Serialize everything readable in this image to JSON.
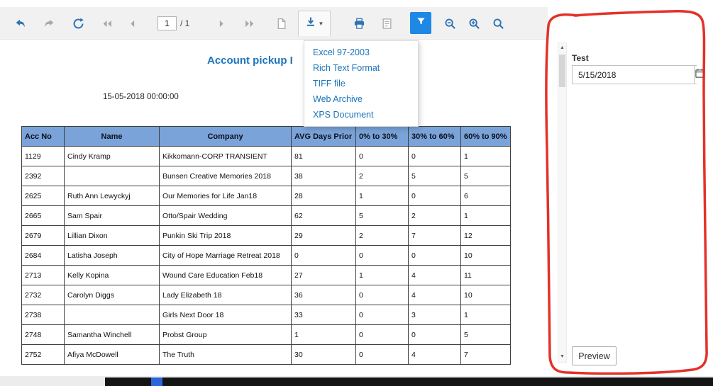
{
  "toolbar": {
    "page_value": "1",
    "page_total_label": "/ 1",
    "icons": [
      "undo",
      "redo",
      "refresh",
      "first-page",
      "previous-page",
      "next-page",
      "last-page",
      "document-map",
      "export-download",
      "print",
      "page-setup",
      "filter",
      "zoom-out",
      "zoom-in",
      "search"
    ]
  },
  "export_menu": {
    "items": [
      "Excel 97-2003",
      "Rich Text Format",
      "TIFF file",
      "Web Archive",
      "XPS Document"
    ]
  },
  "report": {
    "title": "Account pickup I",
    "date": "15-05-2018 00:00:00",
    "table": {
      "headers": [
        "Acc No",
        "Name",
        "Company",
        "AVG Days Prior",
        "0% to 30%",
        "30% to 60%",
        "60% to 90%"
      ],
      "rows": [
        [
          "1129",
          "Cindy Kramp",
          "Kikkomann-CORP TRANSIENT",
          "81",
          "0",
          "0",
          "1"
        ],
        [
          "2392",
          "",
          "Bunsen Creative Memories 2018",
          "38",
          "2",
          "5",
          "5"
        ],
        [
          "2625",
          "Ruth Ann Lewyckyj",
          "Our Memories for Life Jan18",
          "28",
          "1",
          "0",
          "6"
        ],
        [
          "2665",
          "Sam Spair",
          "Otto/Spair Wedding",
          "62",
          "5",
          "2",
          "1"
        ],
        [
          "2679",
          "Lillian Dixon",
          "Punkin Ski Trip 2018",
          "29",
          "2",
          "7",
          "12"
        ],
        [
          "2684",
          "Latisha Joseph",
          "City of Hope Marriage Retreat 2018",
          "0",
          "0",
          "0",
          "10"
        ],
        [
          "2713",
          "Kelly Kopina",
          "Wound Care Education Feb18",
          "27",
          "1",
          "4",
          "11"
        ],
        [
          "2732",
          "Carolyn Diggs",
          "Lady Elizabeth 18",
          "36",
          "0",
          "4",
          "10"
        ],
        [
          "2738",
          "",
          "Girls Next Door 18",
          "33",
          "0",
          "3",
          "1"
        ],
        [
          "2748",
          "Samantha Winchell",
          "Probst Group",
          "1",
          "0",
          "0",
          "5"
        ],
        [
          "2752",
          "Afiya McDowell",
          "The Truth",
          "30",
          "0",
          "4",
          "7"
        ]
      ]
    }
  },
  "panel": {
    "label": "Test",
    "date_value": "5/15/2018",
    "preview_label": "Preview"
  },
  "colors": {
    "accent_blue": "#1e88e5",
    "toolbar_icon_blue": "#2e74b5",
    "toolbar_icon_gray": "#a8a8a8",
    "table_header_bg": "#79a3d9",
    "link_blue": "#1a73b8",
    "title_blue": "#1b75bc",
    "annotation_red": "#e3261b"
  }
}
